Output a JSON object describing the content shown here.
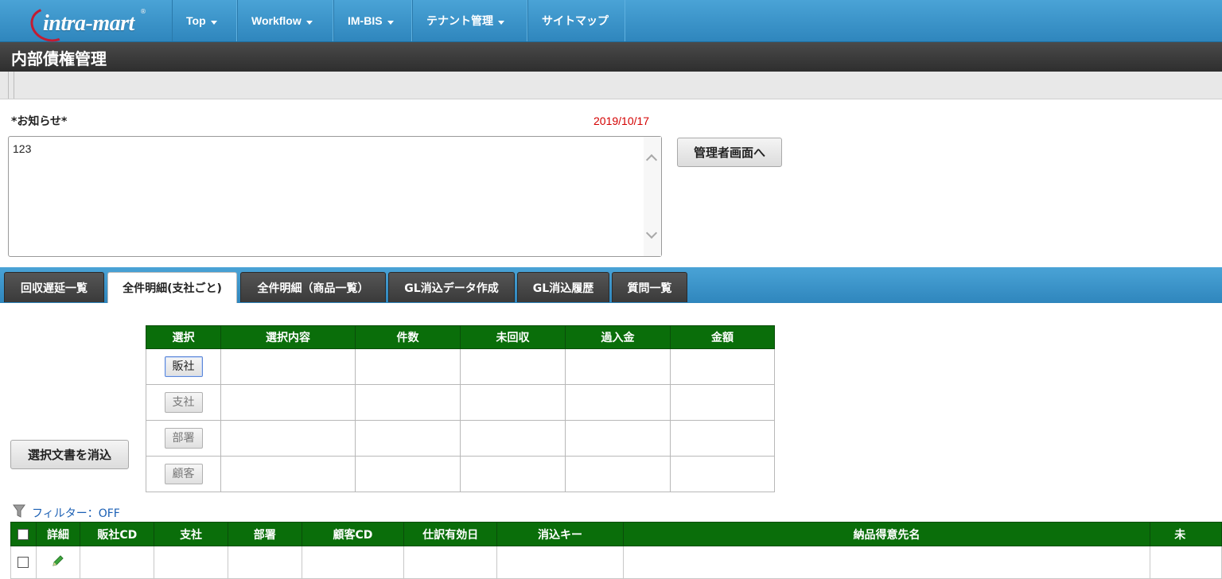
{
  "nav": {
    "logo_text": "intra-mart",
    "items": [
      {
        "label": "Top",
        "dropdown": true
      },
      {
        "label": "Workflow",
        "dropdown": true
      },
      {
        "label": "IM-BIS",
        "dropdown": true
      },
      {
        "label": "テナント管理",
        "dropdown": true
      },
      {
        "label": "サイトマップ",
        "dropdown": false
      }
    ]
  },
  "page": {
    "title": "内部債権管理"
  },
  "notice": {
    "label": "*お知らせ*",
    "date": "2019/10/17",
    "text": "123",
    "admin_button": "管理者画面へ"
  },
  "tabs": [
    {
      "label": "回収遅延一覧",
      "active": false
    },
    {
      "label": "全件明細(支社ごと)",
      "active": true
    },
    {
      "label": "全件明細（商品一覧）",
      "active": false
    },
    {
      "label": "GL消込データ作成",
      "active": false
    },
    {
      "label": "GL消込履歴",
      "active": false
    },
    {
      "label": "質問一覧",
      "active": false
    }
  ],
  "clear_button": "選択文書を消込",
  "selection_table": {
    "headers": [
      "選択",
      "選択内容",
      "件数",
      "未回収",
      "過入金",
      "金額"
    ],
    "rows": [
      {
        "button": "販社",
        "active": true
      },
      {
        "button": "支社",
        "active": false
      },
      {
        "button": "部署",
        "active": false
      },
      {
        "button": "顧客",
        "active": false
      }
    ]
  },
  "filter": {
    "label": "フィルター：OFF"
  },
  "list_table": {
    "headers": [
      "",
      "詳細",
      "販社CD",
      "支社",
      "部署",
      "顧客CD",
      "仕訳有効日",
      "消込キー",
      "納品得意先名",
      "未"
    ]
  },
  "colors": {
    "nav_blue": "#2f86bd",
    "header_green": "#0a6e0a",
    "date_red": "#d40000",
    "link_blue": "#1a5fb4"
  }
}
